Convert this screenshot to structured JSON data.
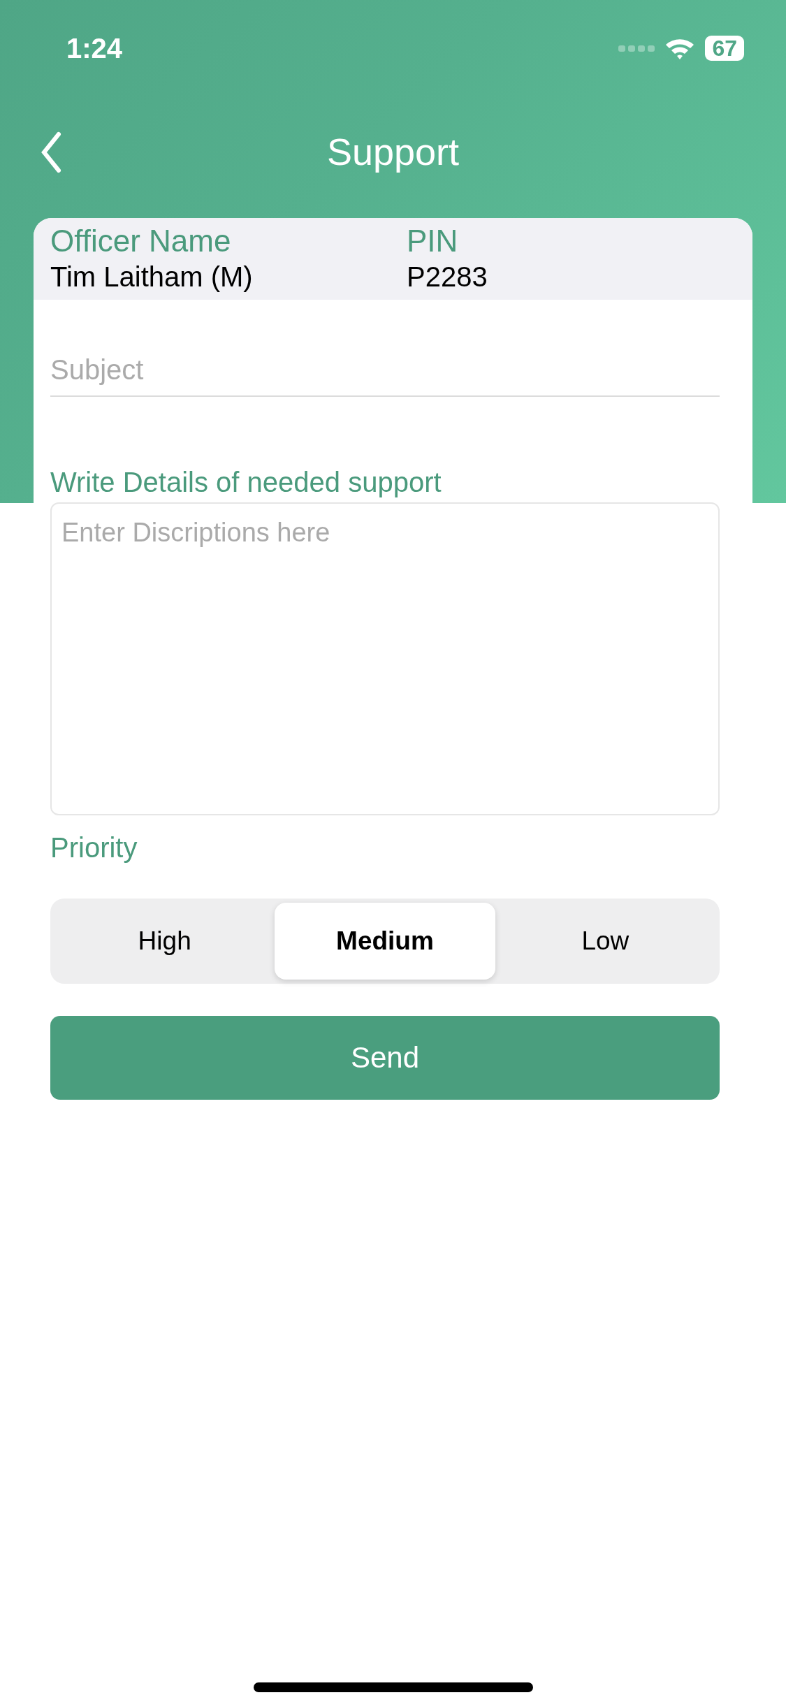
{
  "status_bar": {
    "time": "1:24",
    "battery": "67"
  },
  "nav": {
    "title": "Support"
  },
  "officer": {
    "name_label": "Officer Name",
    "pin_label": "PIN",
    "name": "Tim Laitham (M)",
    "pin": "P2283"
  },
  "subject": {
    "placeholder": "Subject"
  },
  "details": {
    "label": "Write Details of needed support",
    "placeholder": "Enter Discriptions here"
  },
  "priority": {
    "label": "Priority",
    "options": [
      {
        "label": "High",
        "selected": false
      },
      {
        "label": "Medium",
        "selected": true
      },
      {
        "label": "Low",
        "selected": false
      }
    ]
  },
  "send_button": "Send"
}
